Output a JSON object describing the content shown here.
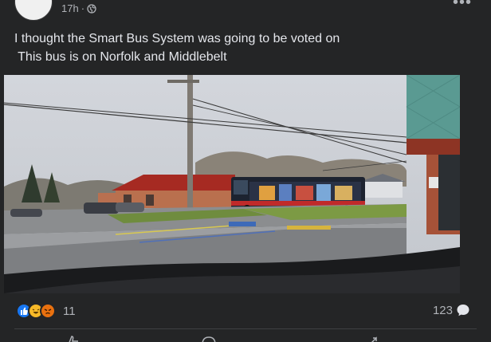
{
  "post": {
    "time": "17h",
    "separator": "·",
    "audience_icon": "globe-icon",
    "text_line1": "I thought the Smart Bus System was going to be voted on",
    "text_line2": " This bus is on Norfolk and Middlebelt"
  },
  "reactions": {
    "icons": [
      "like-icon",
      "haha-icon",
      "angry-icon"
    ],
    "count": "11"
  },
  "comments": {
    "count": "123",
    "icon": "comment-icon"
  },
  "colors": {
    "background": "#242526",
    "text": "#e4e6eb",
    "secondary_text": "#b0b3b8",
    "like": "#1877f2",
    "haha": "#f7b928",
    "angry": "#e9710f"
  }
}
